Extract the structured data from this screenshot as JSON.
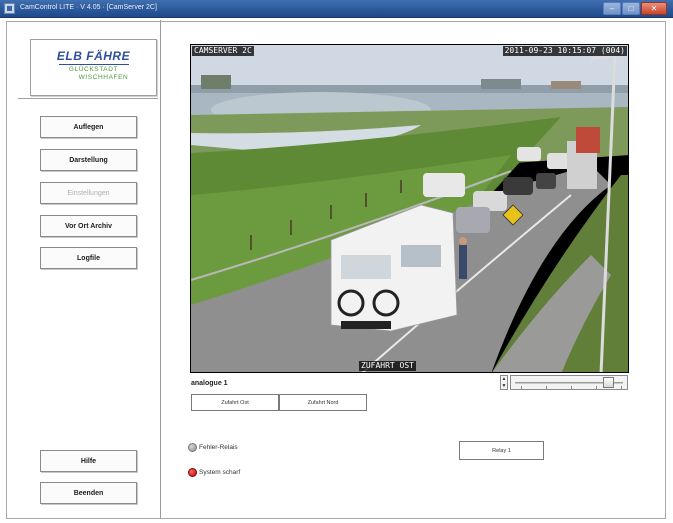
{
  "window": {
    "title": "CamControl LITE · V 4.05 · [CamServer 2C]",
    "minimize_glyph": "–",
    "maximize_glyph": "□",
    "close_glyph": "✕"
  },
  "logo": {
    "title": "ELB FÄHRE",
    "line1": "GLÜCKSTADT",
    "line2": "WISCHHAFEN"
  },
  "nav": {
    "auflegen": "Auflegen",
    "darstellung": "Darstellung",
    "einstellungen": "Einstellungen",
    "vor_ort_archiv": "Vor Ort Archiv",
    "logfile": "Logfile",
    "hilfe": "Hilfe",
    "beenden": "Beenden"
  },
  "camera": {
    "overlay_server": "CAMSERVER 2C",
    "overlay_timestamp": "2011-09-23 10:15:07 (004)",
    "overlay_location": "ZUFAHRT OST",
    "name": "analogue 1",
    "tabs": [
      "Zufahrt Ost",
      "Zufahrt Nord"
    ]
  },
  "controls": {
    "spin_up": "▲",
    "spin_down": "▼"
  },
  "status": {
    "fehler_relais": "Fehler-Relais",
    "system_scharf": "System scharf",
    "relay_button": "Relay 1"
  },
  "colors": {
    "logo_blue": "#2f4f9d",
    "logo_green": "#4a9a3a",
    "indicator_red": "#c00000",
    "indicator_gray": "#8a8a8a"
  }
}
